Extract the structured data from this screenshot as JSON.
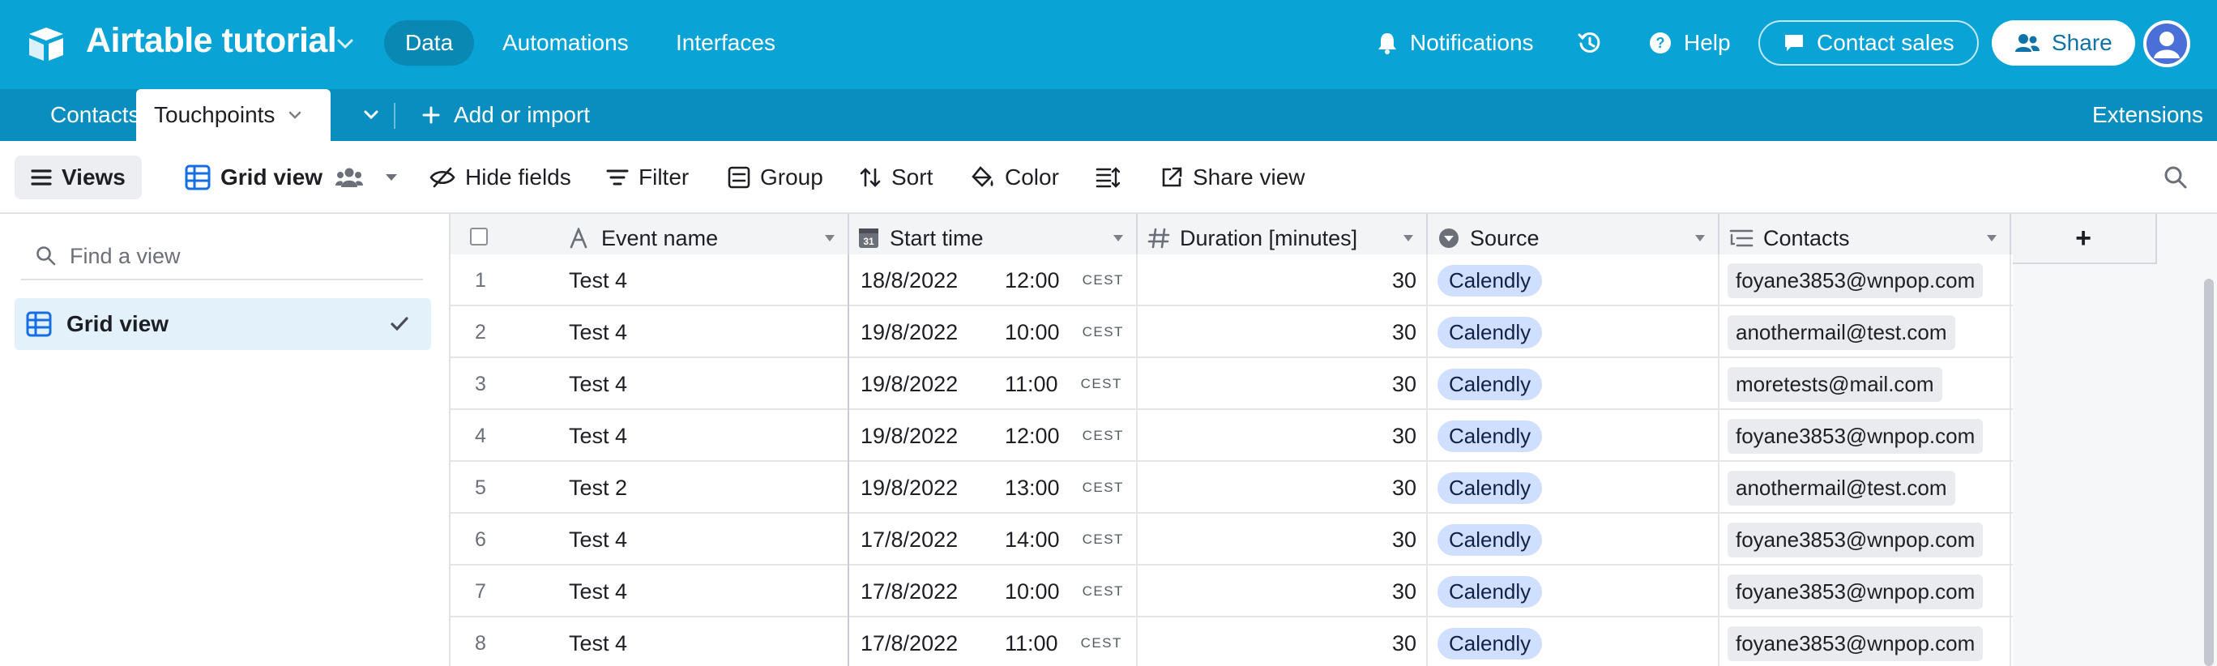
{
  "app": {
    "base_title": "Airtable tutorial",
    "nav": [
      "Data",
      "Automations",
      "Interfaces"
    ],
    "notifications": "Notifications",
    "help": "Help",
    "contact_sales": "Contact sales",
    "share": "Share"
  },
  "tables": {
    "tabs": [
      "Contacts",
      "Touchpoints"
    ],
    "add_or_import": "Add or import",
    "extensions": "Extensions"
  },
  "toolbar": {
    "views": "Views",
    "grid_view": "Grid view",
    "hide_fields": "Hide fields",
    "filter": "Filter",
    "group": "Group",
    "sort": "Sort",
    "color": "Color",
    "share_view": "Share view"
  },
  "sidebar": {
    "find_placeholder": "Find a view",
    "views": [
      "Grid view"
    ]
  },
  "grid": {
    "columns": [
      "Event name",
      "Start time",
      "Duration [minutes]",
      "Source",
      "Contacts"
    ],
    "add_column": "+",
    "rows": [
      {
        "num": "1",
        "event": "Test 4",
        "date": "18/8/2022",
        "time": "12:00",
        "tz": "CEST",
        "duration": "30",
        "source": "Calendly",
        "contact": "foyane3853@wnpop.com"
      },
      {
        "num": "2",
        "event": "Test 4",
        "date": "19/8/2022",
        "time": "10:00",
        "tz": "CEST",
        "duration": "30",
        "source": "Calendly",
        "contact": "anothermail@test.com"
      },
      {
        "num": "3",
        "event": "Test 4",
        "date": "19/8/2022",
        "time": "11:00",
        "tz": "CEST",
        "duration": "30",
        "source": "Calendly",
        "contact": "moretests@mail.com"
      },
      {
        "num": "4",
        "event": "Test 4",
        "date": "19/8/2022",
        "time": "12:00",
        "tz": "CEST",
        "duration": "30",
        "source": "Calendly",
        "contact": "foyane3853@wnpop.com"
      },
      {
        "num": "5",
        "event": "Test 2",
        "date": "19/8/2022",
        "time": "13:00",
        "tz": "CEST",
        "duration": "30",
        "source": "Calendly",
        "contact": "anothermail@test.com"
      },
      {
        "num": "6",
        "event": "Test 4",
        "date": "17/8/2022",
        "time": "14:00",
        "tz": "CEST",
        "duration": "30",
        "source": "Calendly",
        "contact": "foyane3853@wnpop.com"
      },
      {
        "num": "7",
        "event": "Test 4",
        "date": "17/8/2022",
        "time": "10:00",
        "tz": "CEST",
        "duration": "30",
        "source": "Calendly",
        "contact": "foyane3853@wnpop.com"
      },
      {
        "num": "8",
        "event": "Test 4",
        "date": "17/8/2022",
        "time": "11:00",
        "tz": "CEST",
        "duration": "30",
        "source": "Calendly",
        "contact": "foyane3853@wnpop.com"
      }
    ]
  },
  "colors": {
    "appbar": "#0aa3d6",
    "tabbar": "#0a8ec0",
    "source_pill": "#cfdfff"
  }
}
